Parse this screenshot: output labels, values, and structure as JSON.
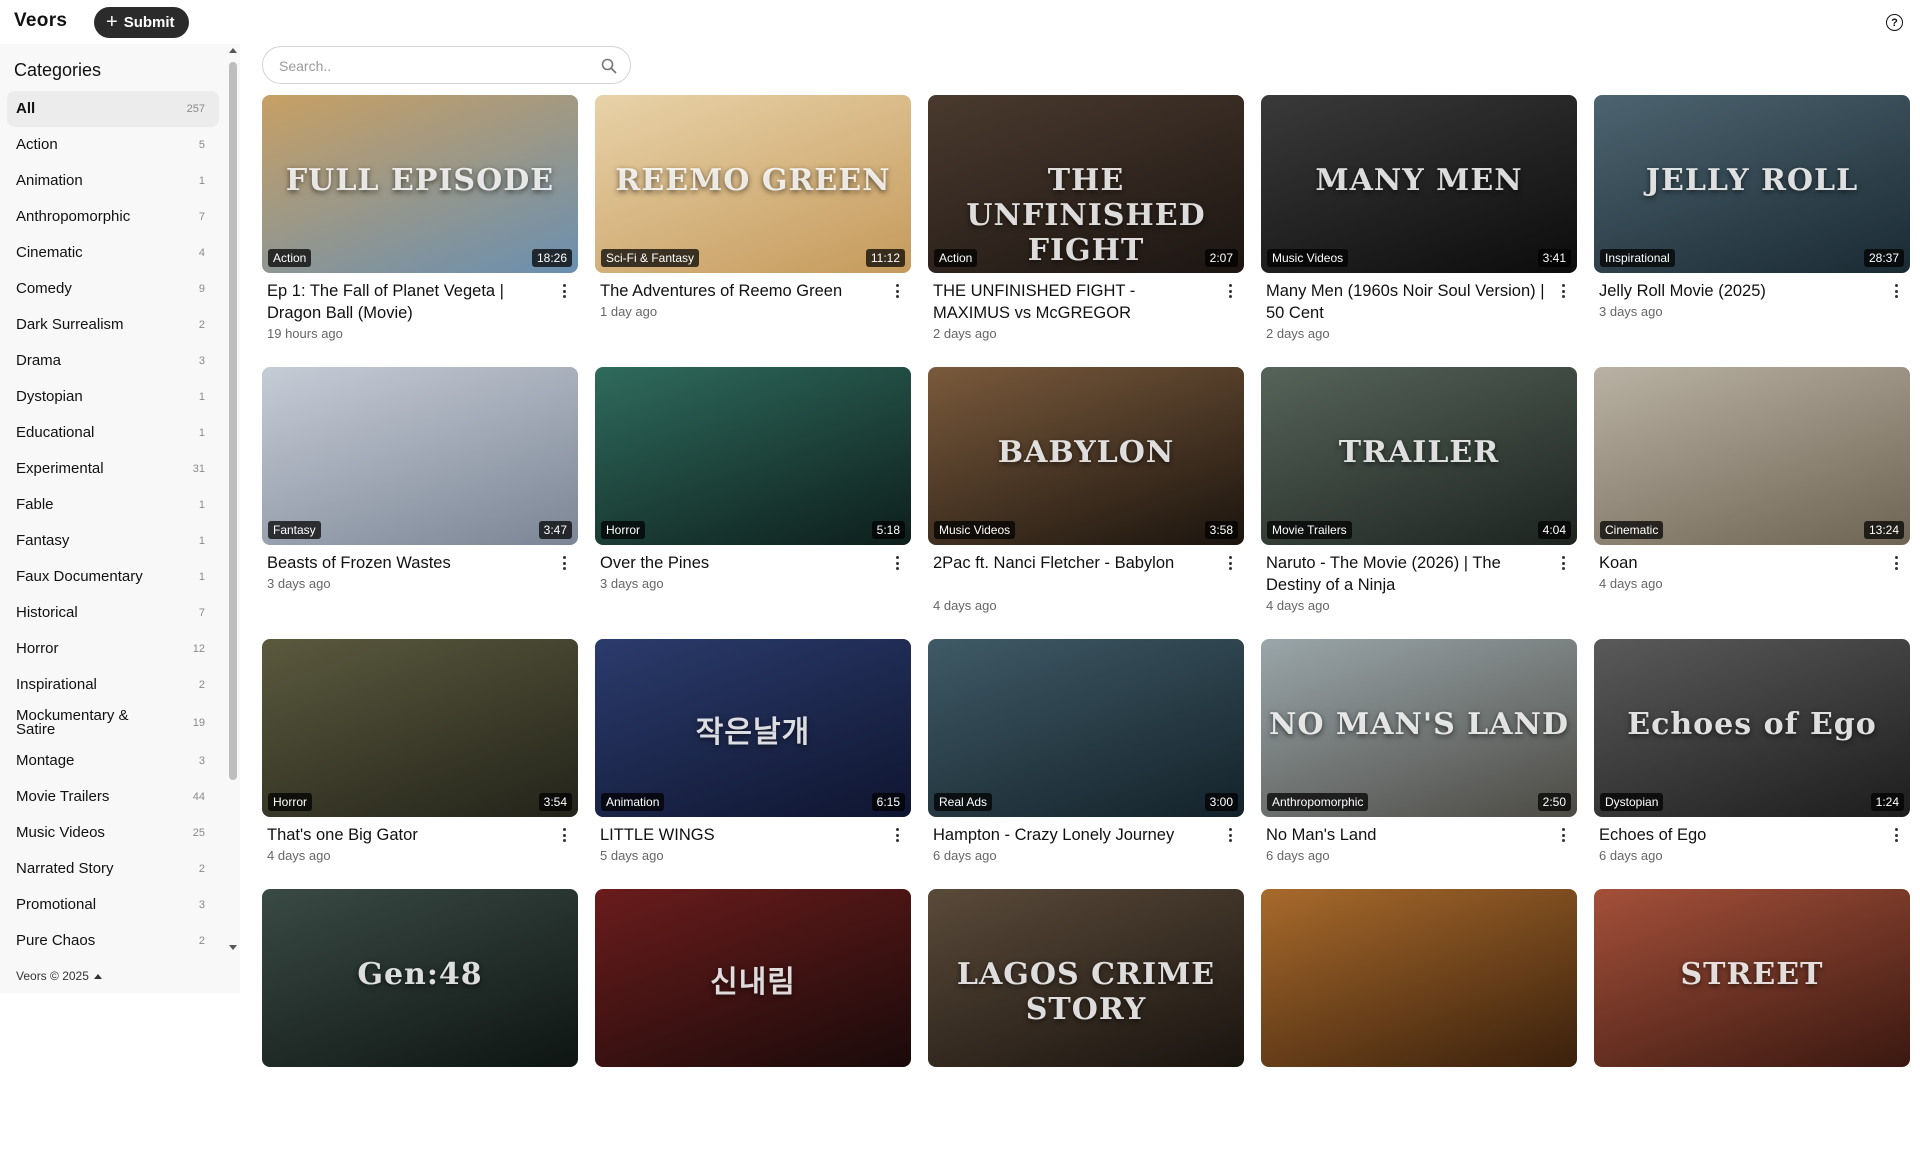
{
  "app": {
    "name": "Veors",
    "submit_label": "Submit",
    "help_symbol": "?"
  },
  "sidebar": {
    "title": "Categories",
    "items": [
      {
        "label": "All",
        "count": "257"
      },
      {
        "label": "Action",
        "count": "5"
      },
      {
        "label": "Animation",
        "count": "1"
      },
      {
        "label": "Anthropomorphic",
        "count": "7"
      },
      {
        "label": "Cinematic",
        "count": "4"
      },
      {
        "label": "Comedy",
        "count": "9"
      },
      {
        "label": "Dark Surrealism",
        "count": "2"
      },
      {
        "label": "Drama",
        "count": "3"
      },
      {
        "label": "Dystopian",
        "count": "1"
      },
      {
        "label": "Educational",
        "count": "1"
      },
      {
        "label": "Experimental",
        "count": "31"
      },
      {
        "label": "Fable",
        "count": "1"
      },
      {
        "label": "Fantasy",
        "count": "1"
      },
      {
        "label": "Faux Documentary",
        "count": "1"
      },
      {
        "label": "Historical",
        "count": "7"
      },
      {
        "label": "Horror",
        "count": "12"
      },
      {
        "label": "Inspirational",
        "count": "2"
      },
      {
        "label": "Mockumentary & Satire",
        "count": "19"
      },
      {
        "label": "Montage",
        "count": "3"
      },
      {
        "label": "Movie Trailers",
        "count": "44"
      },
      {
        "label": "Music Videos",
        "count": "25"
      },
      {
        "label": "Narrated Story",
        "count": "2"
      },
      {
        "label": "Promotional",
        "count": "3"
      },
      {
        "label": "Pure Chaos",
        "count": "2"
      }
    ],
    "footer": "Veors © 2025"
  },
  "search": {
    "placeholder": "Search.."
  },
  "videos": [
    {
      "title": "Ep 1: The Fall of Planet Vegeta | Dragon Ball (Movie)",
      "age": "19 hours ago",
      "category": "Action",
      "duration": "18:26",
      "thumb_text": "FULL EPISODE",
      "colors": [
        "#c8a064",
        "#6a8fb0"
      ]
    },
    {
      "title": "The Adventures of Reemo Green",
      "age": "1 day ago",
      "category": "Sci-Fi & Fantasy",
      "duration": "11:12",
      "thumb_text": "REEMO GREEN",
      "colors": [
        "#e8d2a8",
        "#c59a5c"
      ]
    },
    {
      "title": "THE UNFINISHED FIGHT - MAXIMUS vs McGREGOR",
      "age": "2 days ago",
      "category": "Action",
      "duration": "2:07",
      "thumb_text": "THE UNFINISHED FIGHT",
      "colors": [
        "#4a3a2e",
        "#1c1512"
      ]
    },
    {
      "title": "Many Men (1960s Noir Soul Version) | 50 Cent",
      "age": "2 days ago",
      "category": "Music Videos",
      "duration": "3:41",
      "thumb_text": "MANY MEN",
      "colors": [
        "#3a3a3a",
        "#0c0c0c"
      ]
    },
    {
      "title": "Jelly Roll Movie (2025)",
      "age": "3 days ago",
      "category": "Inspirational",
      "duration": "28:37",
      "thumb_text": "JELLY ROLL",
      "colors": [
        "#4d6470",
        "#1a2a33"
      ]
    },
    {
      "title": "Beasts of Frozen Wastes",
      "age": "3 days ago",
      "category": "Fantasy",
      "duration": "3:47",
      "thumb_text": "",
      "colors": [
        "#c6ccd6",
        "#7b8595"
      ]
    },
    {
      "title": "Over the Pines",
      "age": "3 days ago",
      "category": "Horror",
      "duration": "5:18",
      "thumb_text": "",
      "colors": [
        "#2f6b5d",
        "#0d1e1b"
      ]
    },
    {
      "title": "2Pac ft. Nanci Fletcher - Babylon",
      "age": "4 days ago",
      "category": "Music Videos",
      "duration": "3:58",
      "thumb_text": "BABYLON",
      "colors": [
        "#7a5a3c",
        "#1b140e"
      ]
    },
    {
      "title": "Naruto - The Movie (2026) | The Destiny of a Ninja",
      "age": "4 days ago",
      "category": "Movie Trailers",
      "duration": "4:04",
      "thumb_text": "TRAILER",
      "colors": [
        "#56645a",
        "#1d2420"
      ]
    },
    {
      "title": "Koan",
      "age": "4 days ago",
      "category": "Cinematic",
      "duration": "13:24",
      "thumb_text": "",
      "colors": [
        "#b9b1a3",
        "#6e6453"
      ]
    },
    {
      "title": "That's one Big Gator",
      "age": "4 days ago",
      "category": "Horror",
      "duration": "3:54",
      "thumb_text": "",
      "colors": [
        "#5b5a3e",
        "#23231a"
      ]
    },
    {
      "title": "LITTLE WINGS",
      "age": "5 days ago",
      "category": "Animation",
      "duration": "6:15",
      "thumb_text": "작은날개",
      "colors": [
        "#2b3b6c",
        "#0f1530"
      ]
    },
    {
      "title": "Hampton - Crazy Lonely Journey",
      "age": "6 days ago",
      "category": "Real Ads",
      "duration": "3:00",
      "thumb_text": "",
      "colors": [
        "#3f5a66",
        "#14222a"
      ]
    },
    {
      "title": "No Man's Land",
      "age": "6 days ago",
      "category": "Anthropomorphic",
      "duration": "2:50",
      "thumb_text": "NO MAN'S LAND",
      "colors": [
        "#9aa6aa",
        "#4c4a44"
      ]
    },
    {
      "title": "Echoes of Ego",
      "age": "6 days ago",
      "category": "Dystopian",
      "duration": "1:24",
      "thumb_text": "Echoes of Ego",
      "colors": [
        "#5a5a5a",
        "#1d1d1d"
      ]
    },
    {
      "title": "",
      "age": "",
      "category": "",
      "duration": "",
      "thumb_text": "Gen:48",
      "colors": [
        "#3a4a44",
        "#0e1513"
      ]
    },
    {
      "title": "",
      "age": "",
      "category": "",
      "duration": "",
      "thumb_text": "신내림",
      "colors": [
        "#6a1c1c",
        "#1a0a0a"
      ]
    },
    {
      "title": "",
      "age": "",
      "category": "",
      "duration": "",
      "thumb_text": "LAGOS CRIME STORY",
      "colors": [
        "#5a4a3a",
        "#1a140f"
      ]
    },
    {
      "title": "",
      "age": "",
      "category": "",
      "duration": "",
      "thumb_text": "",
      "colors": [
        "#a86a2c",
        "#3a200c"
      ]
    },
    {
      "title": "",
      "age": "",
      "category": "",
      "duration": "",
      "thumb_text": "STREET",
      "colors": [
        "#a4503a",
        "#3a1810"
      ]
    }
  ]
}
